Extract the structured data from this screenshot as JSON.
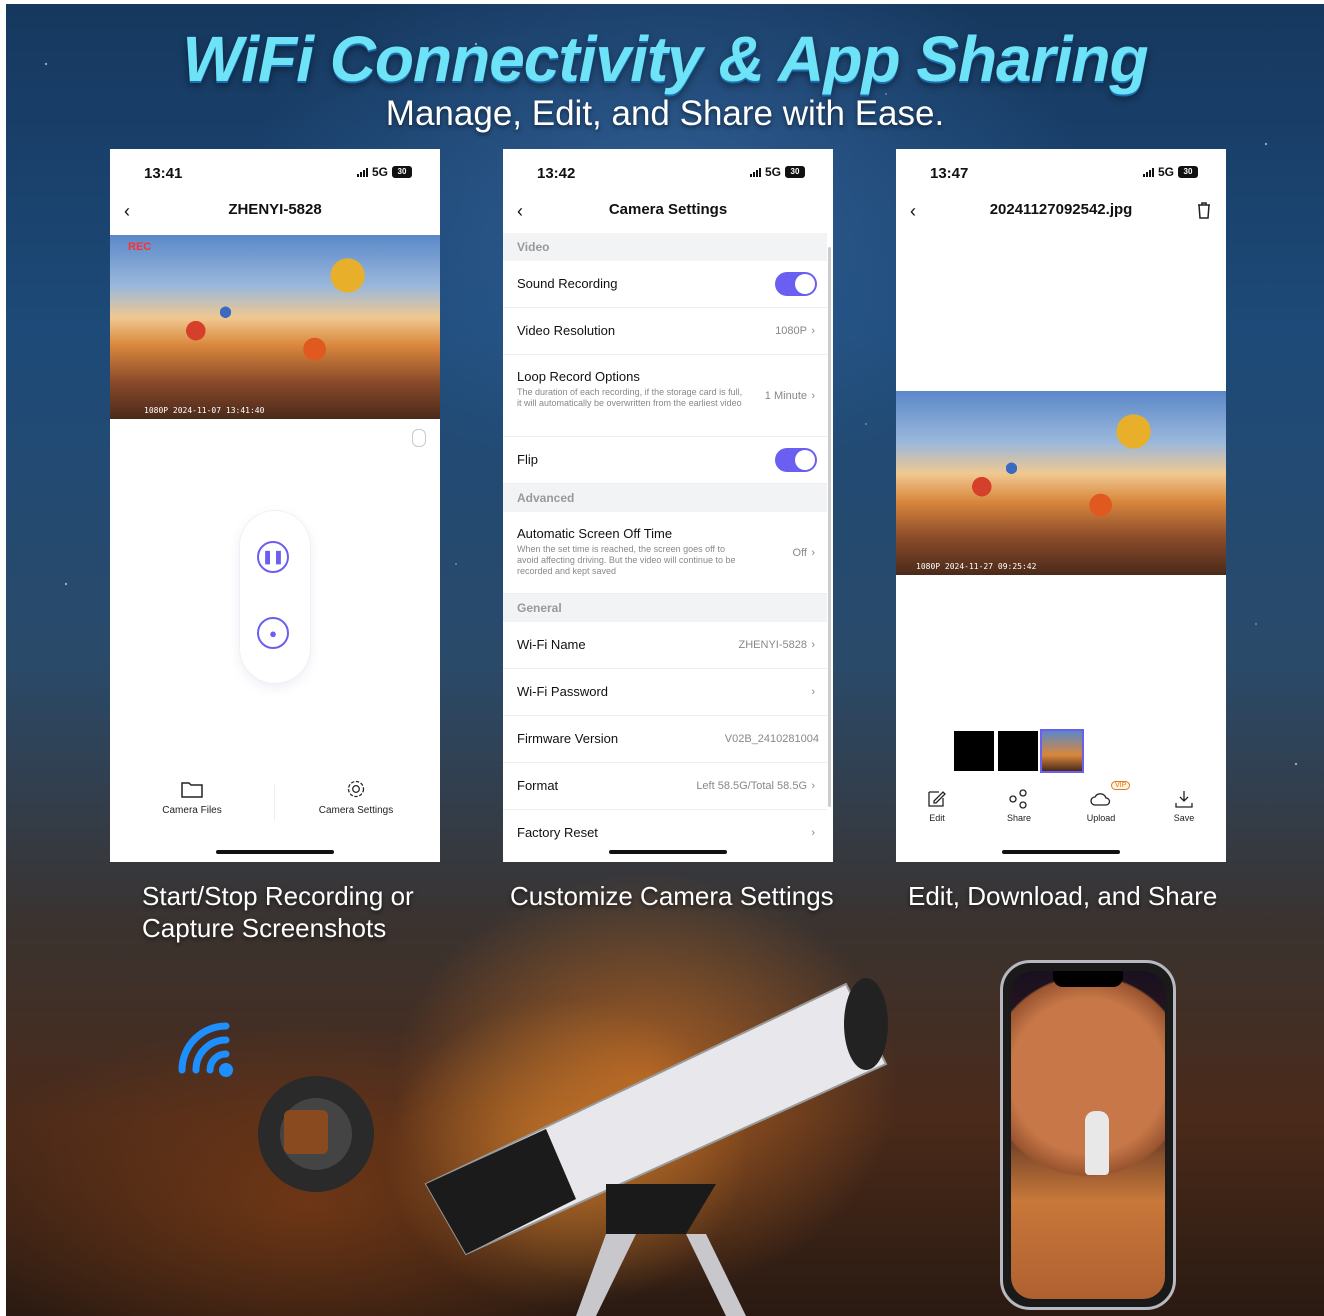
{
  "headline": {
    "title": "WiFi Connectivity & App Sharing",
    "subtitle": "Manage, Edit, and Share with Ease."
  },
  "phone1": {
    "time": "13:41",
    "network": "5G",
    "battery": "30",
    "title": "ZHENYI-5828",
    "rec_label": "REC",
    "stamp": "1080P 2024-11-07 13:41:40",
    "tabs": [
      {
        "label": "Camera Files",
        "icon": "folder-icon"
      },
      {
        "label": "Camera Settings",
        "icon": "gear-icon"
      }
    ]
  },
  "phone2": {
    "time": "13:42",
    "network": "5G",
    "battery": "30",
    "title": "Camera Settings",
    "sections": {
      "video": "Video",
      "advanced": "Advanced",
      "general": "General"
    },
    "rows": {
      "sound_recording": {
        "label": "Sound Recording",
        "on": true
      },
      "video_resolution": {
        "label": "Video Resolution",
        "value": "1080P"
      },
      "loop_record": {
        "label": "Loop Record Options",
        "desc": "The duration of each recording, if the storage card is full, it will automatically be overwritten from the earliest video",
        "value": "1 Minute"
      },
      "flip": {
        "label": "Flip",
        "on": true
      },
      "screen_off": {
        "label": "Automatic Screen Off Time",
        "desc": "When the set time is reached, the screen goes off to avoid affecting driving. But the video will continue to be recorded and kept saved",
        "value": "Off"
      },
      "wifi_name": {
        "label": "Wi-Fi Name",
        "value": "ZHENYI-5828"
      },
      "wifi_password": {
        "label": "Wi-Fi Password"
      },
      "firmware": {
        "label": "Firmware Version",
        "value": "V02B_2410281004"
      },
      "format": {
        "label": "Format",
        "value": "Left 58.5G/Total 58.5G"
      },
      "factory_reset": {
        "label": "Factory Reset"
      }
    }
  },
  "phone3": {
    "time": "13:47",
    "network": "5G",
    "battery": "30",
    "title": "20241127092542.jpg",
    "stamp": "1080P 2024-11-27 09:25:42",
    "actions": [
      {
        "label": "Edit",
        "icon": "edit-icon"
      },
      {
        "label": "Share",
        "icon": "share-icon"
      },
      {
        "label": "Upload",
        "icon": "cloud-upload-icon",
        "badge": "VIP"
      },
      {
        "label": "Save",
        "icon": "download-icon"
      }
    ]
  },
  "captions": {
    "c1": "Start/Stop Recording or Capture Screenshots",
    "c2": "Customize Camera Settings",
    "c3": "Edit, Download, and Share"
  },
  "colors": {
    "accent": "#6a5ff0",
    "title": "#6ee3f7",
    "wifi": "#1e8fff"
  }
}
